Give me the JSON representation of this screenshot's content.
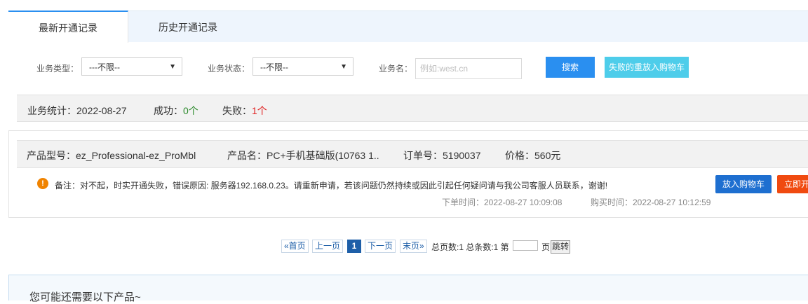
{
  "tabs": [
    {
      "label": "最新开通记录",
      "active": true
    },
    {
      "label": "历史开通记录",
      "active": false
    }
  ],
  "filters": {
    "type_label": "业务类型：",
    "type_value": "---不限--",
    "status_label": "业务状态：",
    "status_value": "--不限--",
    "name_label": "业务名：",
    "name_placeholder": "例如:west.cn",
    "search_button": "搜索",
    "retry_button": "失败的重放入购物车"
  },
  "stats": {
    "date_text": "业务统计：2022-08-27",
    "success_label": "成功：",
    "success_value": "0个",
    "fail_label": "失败：",
    "fail_value": "1个"
  },
  "record": {
    "model": "产品型号：ez_Professional-ez_ProMbl",
    "name": "产品名：PC+手机基础版(10763 1..",
    "order": "订单号：5190037",
    "price": "价格：560元",
    "remark": "备注：对不起，时实开通失败，错误原因: 服务器192.168.0.23。请重新申请，若该问题仍然持续或因此引起任何疑问请与我公司客服人员联系，谢谢!",
    "order_time": "下单时间：2022-08-27 10:09:08",
    "buy_time": "购买时间：2022-08-27 10:12:59",
    "cart_button": "放入购物车",
    "open_button": "立即开",
    "warn_icon_glyph": "!"
  },
  "pagination": {
    "first": "«首页",
    "prev": "上一页",
    "current": "1",
    "next": "下一页",
    "last": "末页»",
    "summary": "总页数:1 总条数:1 第",
    "page_unit": "页",
    "go": "跳转"
  },
  "recommend": {
    "title": "您可能还需要以下产品~"
  },
  "colors": {
    "accent": "#2a8ff0",
    "success": "#2e8b2e",
    "fail": "#e02020",
    "cart": "#1e6fd0",
    "open": "#f04a10",
    "retry": "#4ecdea"
  }
}
